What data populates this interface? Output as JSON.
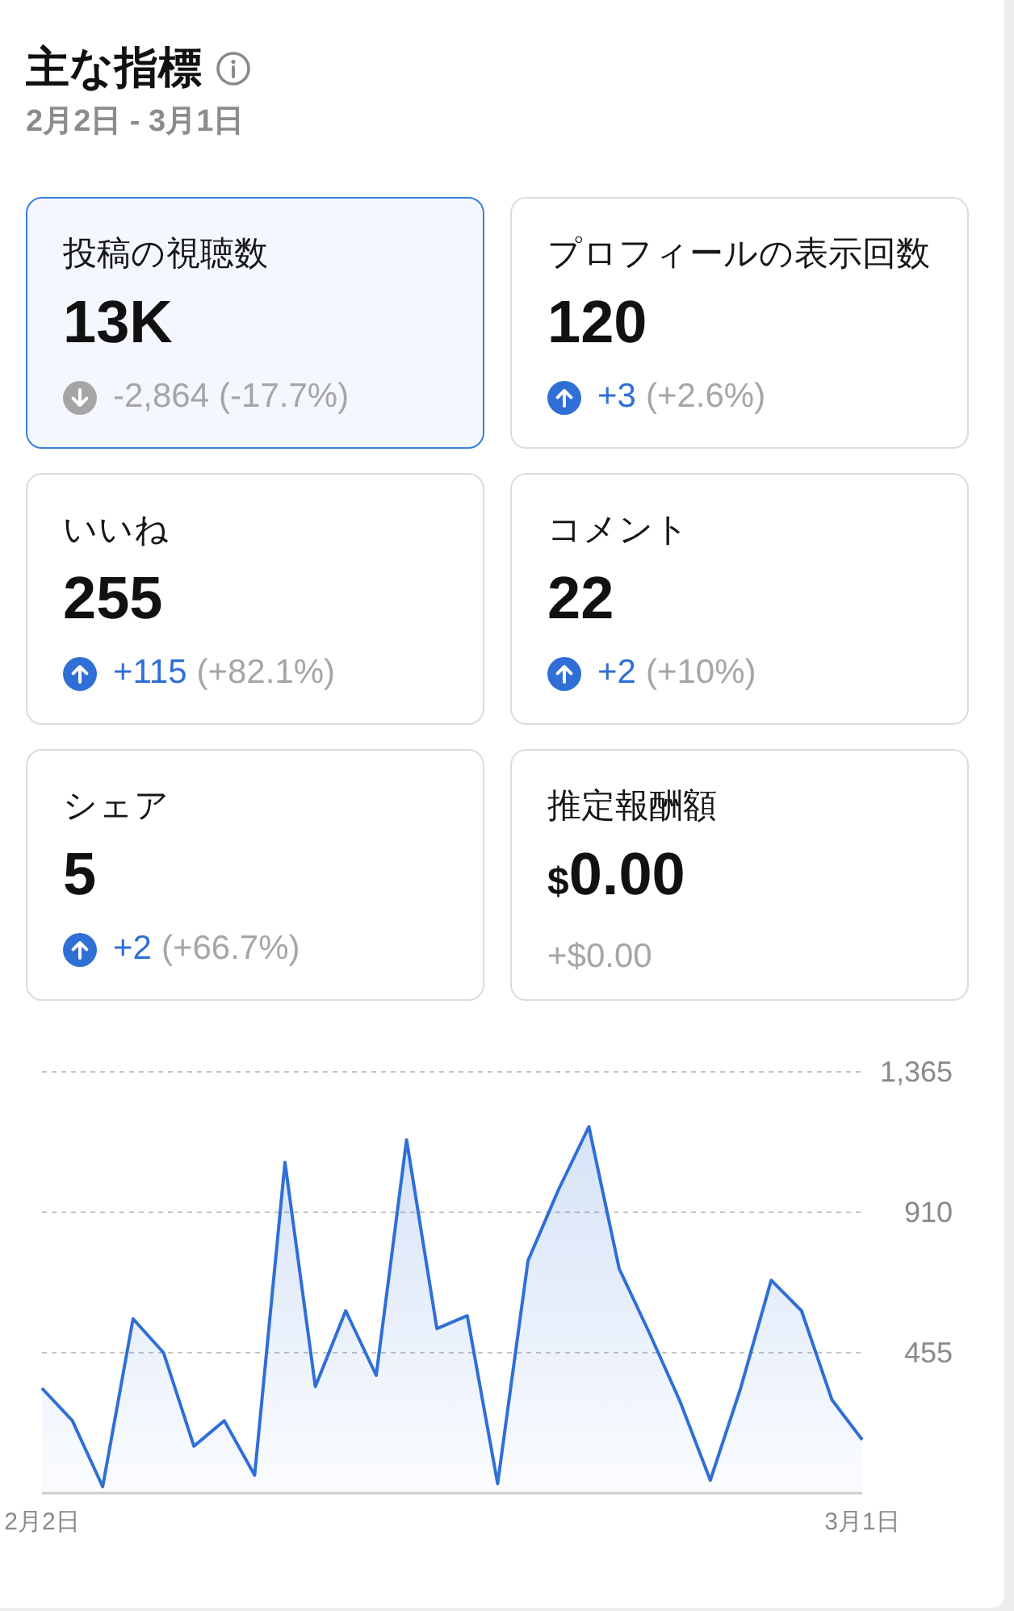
{
  "header": {
    "title": "主な指標",
    "date_range": "2月2日 - 3月1日"
  },
  "metrics": [
    {
      "label": "投稿の視聴数",
      "value": "13K",
      "selected": true,
      "change": {
        "kind": "down",
        "delta": "-2,864",
        "percent": "(-17.7%)"
      }
    },
    {
      "label": "プロフィールの表示回数",
      "value": "120",
      "selected": false,
      "change": {
        "kind": "up",
        "delta": "+3",
        "percent": "(+2.6%)"
      }
    },
    {
      "label": "いいね",
      "value": "255",
      "selected": false,
      "change": {
        "kind": "up",
        "delta": "+115",
        "percent": "(+82.1%)"
      }
    },
    {
      "label": "コメント",
      "value": "22",
      "selected": false,
      "change": {
        "kind": "up",
        "delta": "+2",
        "percent": "(+10%)"
      }
    },
    {
      "label": "シェア",
      "value": "5",
      "selected": false,
      "change": {
        "kind": "up",
        "delta": "+2",
        "percent": "(+66.7%)"
      }
    },
    {
      "label": "推定報酬額",
      "currency": "$",
      "value": "0.00",
      "selected": false,
      "change": {
        "kind": "none",
        "delta": "+$0.00"
      }
    }
  ],
  "chart": {
    "chart_data": {
      "type": "area",
      "categories": [
        "2月2日",
        null,
        null,
        null,
        null,
        null,
        null,
        null,
        null,
        null,
        null,
        null,
        null,
        null,
        null,
        null,
        null,
        null,
        null,
        null,
        null,
        null,
        null,
        null,
        null,
        null,
        null,
        "3月1日"
      ],
      "series": [
        {
          "color": "#2f6fd6",
          "values": [
            340,
            235,
            21,
            565,
            455,
            152,
            235,
            58,
            1072,
            345,
            591,
            382,
            1145,
            533,
            575,
            31,
            753,
            983,
            1187,
            727,
            518,
            298,
            42,
            340,
            690,
            591,
            303,
            173
          ]
        }
      ],
      "ylim": [
        0,
        1365
      ],
      "yticks": [
        {
          "value": 455,
          "label": "455"
        },
        {
          "value": 910,
          "label": "910"
        },
        {
          "value": 1365,
          "label": "1,365"
        }
      ]
    }
  }
}
